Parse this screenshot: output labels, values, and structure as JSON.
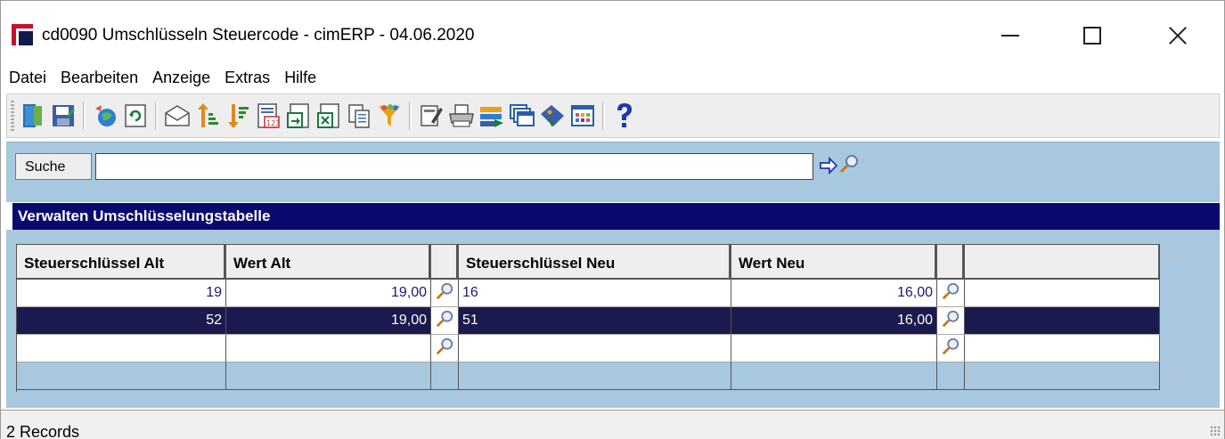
{
  "window": {
    "title": "cd0090 Umschlüsseln Steuercode - cimERP - 04.06.2020"
  },
  "menu": [
    {
      "label": "Datei"
    },
    {
      "label": "Bearbeiten"
    },
    {
      "label": "Anzeige"
    },
    {
      "label": "Extras"
    },
    {
      "label": "Hilfe"
    }
  ],
  "toolbar": {
    "icons": [
      "exit-door-icon",
      "save-icon",
      "refresh-globe-icon",
      "reload-icon",
      "mail-icon",
      "sort-ascending-icon",
      "sort-descending-icon",
      "number-format-icon",
      "export-icon",
      "excel-export-icon",
      "copy-icon",
      "filter-icon",
      "edit-form-icon",
      "print-icon",
      "transfer-icon",
      "windows-icon",
      "tag-icon",
      "grid-view-icon",
      "help-icon"
    ]
  },
  "search": {
    "label": "Suche",
    "value": "",
    "placeholder": ""
  },
  "section": {
    "title": "Verwalten Umschlüsselungstabelle"
  },
  "table": {
    "columns": [
      "Steuerschlüssel Alt",
      "Wert Alt",
      "",
      "Steuerschlüssel Neu",
      "Wert Neu",
      "",
      ""
    ],
    "rows": [
      {
        "schluessel_alt": "19",
        "wert_alt": "19,00",
        "schluessel_neu": "16",
        "wert_neu": "16,00",
        "selected": false
      },
      {
        "schluessel_alt": "52",
        "wert_alt": "19,00",
        "schluessel_neu": "51",
        "wert_neu": "16,00",
        "selected": true
      },
      {
        "schluessel_alt": "",
        "wert_alt": "",
        "schluessel_neu": "",
        "wert_neu": "",
        "selected": false
      }
    ]
  },
  "status": {
    "records": "2 Records"
  },
  "colors": {
    "section_header": "#0a0a6e",
    "panel_blue": "#a8c8e0",
    "selected_row": "#1a1a4e"
  }
}
